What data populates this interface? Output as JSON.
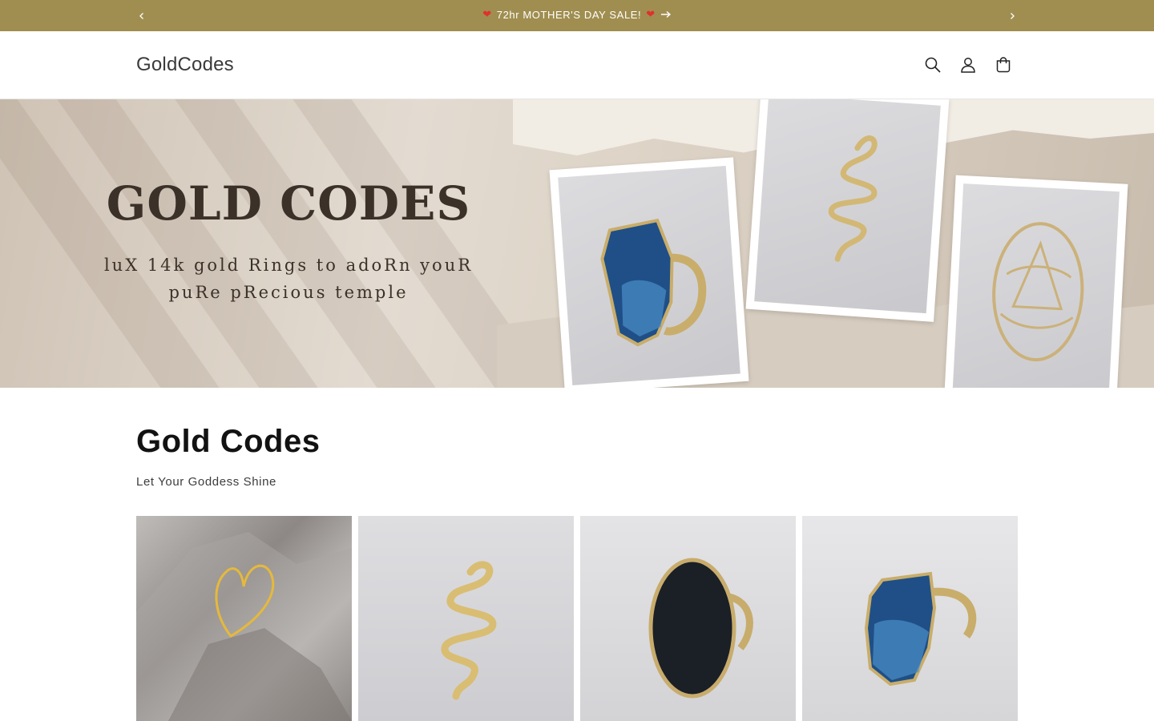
{
  "announcement": {
    "message": "72hr MOTHER'S DAY SALE!",
    "heart": "❤",
    "prev_icon": "chevron-left-icon",
    "next_icon": "chevron-right-icon",
    "arrow_icon": "arrow-right-icon",
    "background": "#a08e50"
  },
  "header": {
    "logo": "GoldCodes",
    "icons": [
      "search-icon",
      "account-icon",
      "cart-icon"
    ]
  },
  "hero": {
    "title": "GOLD CODES",
    "subtitle_line1": "luX 14k gold Rings to adoRn youR",
    "subtitle_line2": "puRe pRecious temple"
  },
  "collection": {
    "title": "Gold Codes",
    "subtitle": "Let Your Goddess Shine"
  }
}
